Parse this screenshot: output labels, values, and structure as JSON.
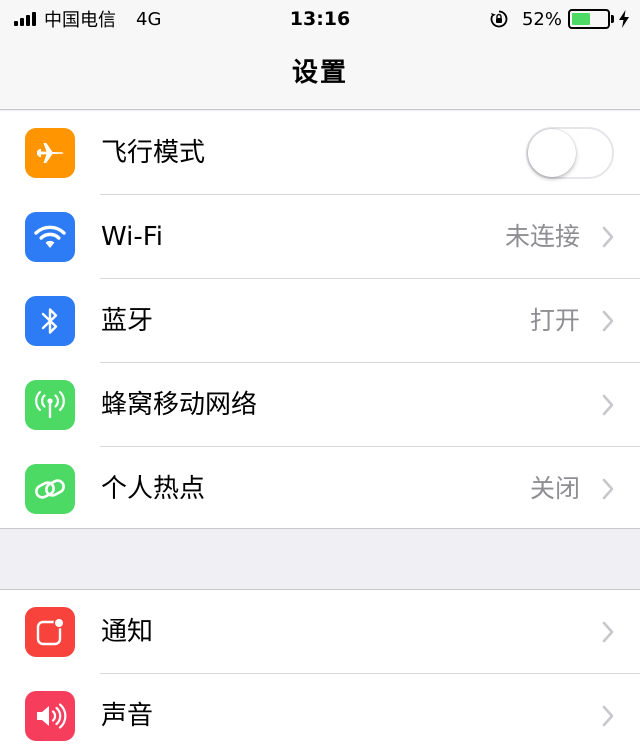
{
  "status_bar": {
    "carrier": "中国电信",
    "network": "4G",
    "time": "13:16",
    "battery_percent": "52%",
    "battery_level": 0.52,
    "icons": [
      "signal-icon",
      "orientation-lock-icon",
      "battery-icon",
      "charging-bolt-icon"
    ]
  },
  "nav": {
    "title": "设置"
  },
  "groups": [
    {
      "rows": [
        {
          "label": "飞行模式",
          "icon": "airplane-icon",
          "icon_color": "#ff9500",
          "control": "toggle",
          "toggle_on": false
        },
        {
          "label": "Wi-Fi",
          "icon": "wifi-icon",
          "icon_color": "#2d7cf6",
          "value": "未连接",
          "control": "chevron"
        },
        {
          "label": "蓝牙",
          "icon": "bluetooth-icon",
          "icon_color": "#2d7cf6",
          "value": "打开",
          "control": "chevron"
        },
        {
          "label": "蜂窝移动网络",
          "icon": "cellular-antenna-icon",
          "icon_color": "#4cd964",
          "value": "",
          "control": "chevron"
        },
        {
          "label": "个人热点",
          "icon": "hotspot-link-icon",
          "icon_color": "#4cd964",
          "value": "关闭",
          "control": "chevron"
        }
      ]
    },
    {
      "rows": [
        {
          "label": "通知",
          "icon": "notifications-icon",
          "icon_color": "#f8433c",
          "control": "chevron"
        },
        {
          "label": "声音",
          "icon": "speaker-icon",
          "icon_color": "#f63d5c",
          "control": "chevron"
        }
      ]
    }
  ]
}
